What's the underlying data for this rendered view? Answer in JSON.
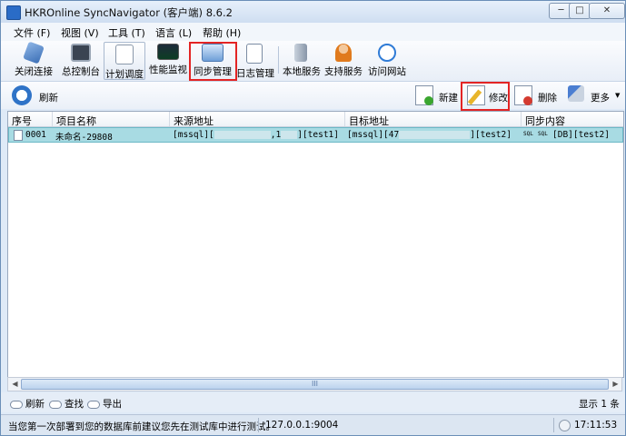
{
  "window": {
    "title": "HKROnline SyncNavigator (客户端) 8.6.2",
    "minimize_glyph": "─",
    "maximize_glyph": "□",
    "close_glyph": "✕"
  },
  "menu": [
    "文件 (F)",
    "视图 (V)",
    "工具 (T)",
    "语言 (L)",
    "帮助 (H)"
  ],
  "toolbar": {
    "items": [
      {
        "label": "关闭连接",
        "icon": "plug-icon"
      },
      {
        "label": "总控制台",
        "icon": "console-icon"
      },
      {
        "label": "计划调度",
        "icon": "schedule-icon",
        "state": "active"
      },
      {
        "label": "性能监视",
        "icon": "monitor-chart-icon"
      },
      {
        "label": "同步管理",
        "icon": "sync-manage-icon",
        "highlighted": true
      },
      {
        "label": "日志管理",
        "icon": "log-search-icon"
      },
      {
        "label": "本地服务",
        "icon": "server-icon"
      },
      {
        "label": "支持服务",
        "icon": "support-person-icon"
      },
      {
        "label": "访问网站",
        "icon": "web-refresh-icon"
      }
    ]
  },
  "actions": {
    "refresh": "刷新",
    "new": "新建",
    "edit": "修改",
    "delete": "删除",
    "more": "更多"
  },
  "table": {
    "columns": [
      "序号",
      "项目名称",
      "来源地址",
      "目标地址",
      "同步内容"
    ],
    "rows": [
      {
        "id": "0001",
        "name": "未命名-29808",
        "source_prefix": "[mssql][",
        "source_mid": ",1",
        "source_suffix": "][test1]",
        "target_prefix": "[mssql][47",
        "target_suffix": "][test2]",
        "content_badge1": "SQL",
        "content_badge2": "SQL",
        "content": "[DB][test2]"
      }
    ]
  },
  "scrollbar": {
    "left_arrow": "◀",
    "right_arrow": "▶",
    "grip": "III"
  },
  "bottom": {
    "refresh": "刷新",
    "find": "查找",
    "export": "导出",
    "count": "显示 1 条"
  },
  "status": {
    "message": "当您第一次部署到您的数据库前建议您先在测试库中进行测试。",
    "address": "127.0.0.1:9004",
    "time": "17:11:53"
  },
  "colors": {
    "highlight_box": "#e32424",
    "selected_row": "#a8dbe3"
  }
}
